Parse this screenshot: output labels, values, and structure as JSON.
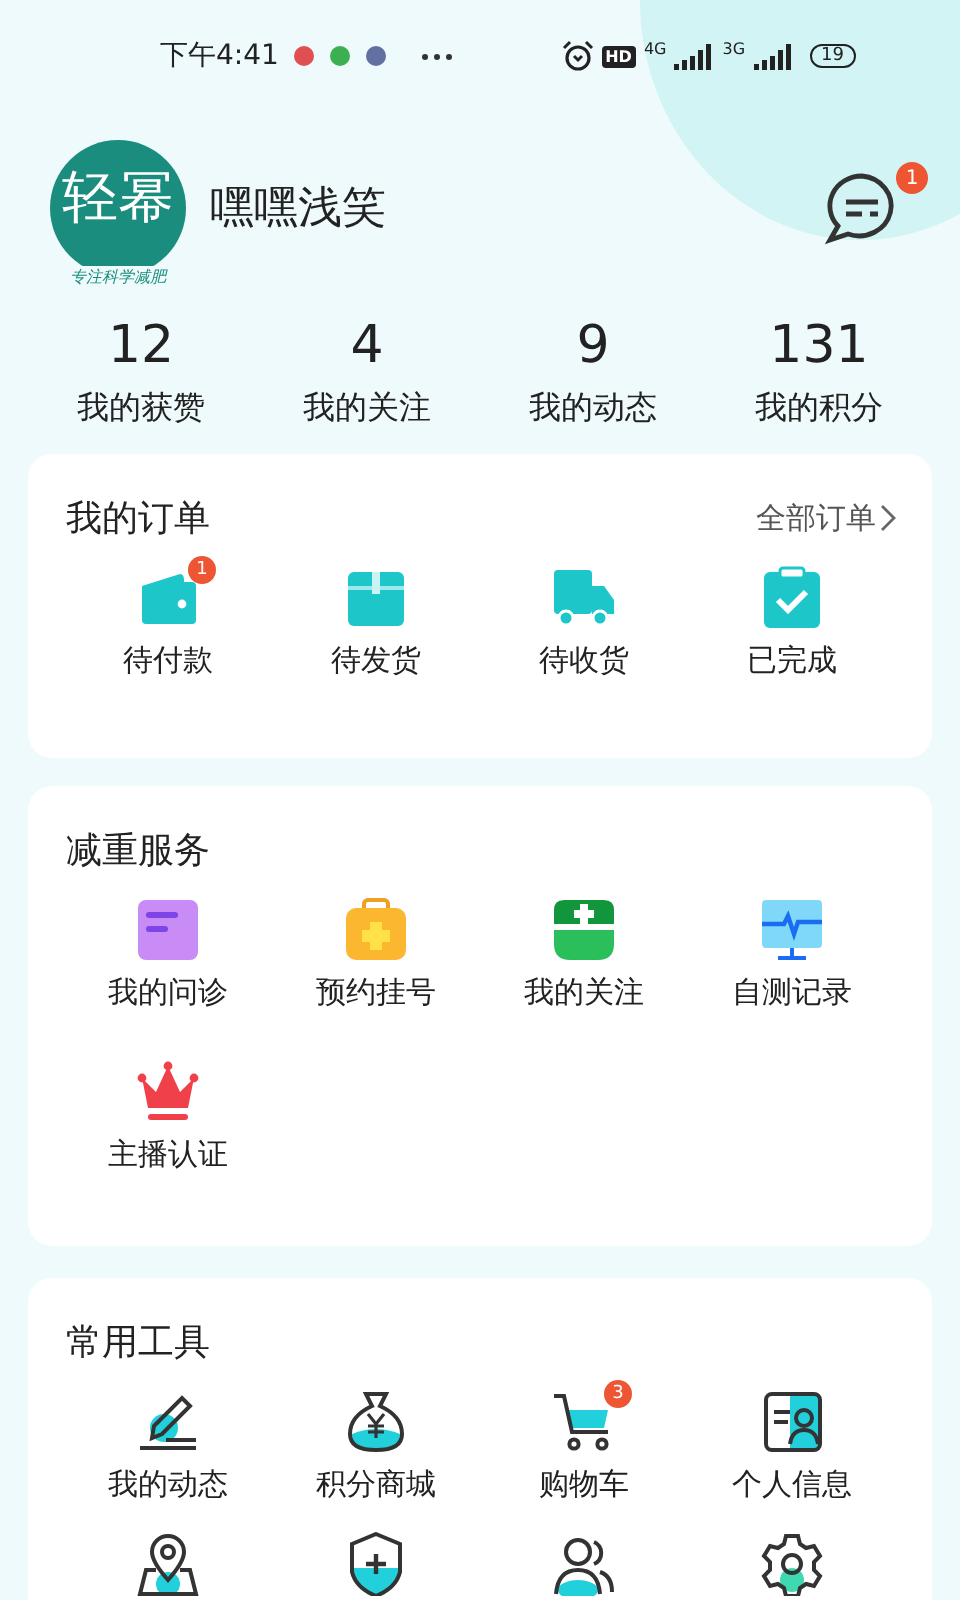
{
  "status_bar": {
    "time": "下午4:41",
    "network_1": "4G",
    "network_2": "3G",
    "hd": "HD",
    "battery": "19"
  },
  "profile": {
    "logo_text": "轻幂",
    "logo_slogan": "专注科学减肥",
    "username": "嘿嘿浅笑",
    "message_badge": "1"
  },
  "stats": [
    {
      "value": "12",
      "label": "我的获赞"
    },
    {
      "value": "4",
      "label": "我的关注"
    },
    {
      "value": "9",
      "label": "我的动态"
    },
    {
      "value": "131",
      "label": "我的积分"
    }
  ],
  "orders": {
    "title": "我的订单",
    "link": "全部订单",
    "items": [
      {
        "kind": "wallet",
        "label": "待付款",
        "badge": "1"
      },
      {
        "kind": "box",
        "label": "待发货"
      },
      {
        "kind": "truck",
        "label": "待收货"
      },
      {
        "kind": "clipboard",
        "label": "已完成"
      }
    ]
  },
  "services": {
    "title": "减重服务",
    "items": [
      {
        "kind": "note",
        "label": "我的问诊"
      },
      {
        "kind": "medkit",
        "label": "预约挂号"
      },
      {
        "kind": "cross",
        "label": "我的关注"
      },
      {
        "kind": "monitor",
        "label": "自测记录"
      },
      {
        "kind": "crown",
        "label": "主播认证"
      }
    ]
  },
  "tools": {
    "title": "常用工具",
    "items": [
      {
        "kind": "pen",
        "label": "我的动态"
      },
      {
        "kind": "moneybag",
        "label": "积分商城"
      },
      {
        "kind": "cart",
        "label": "购物车",
        "badge": "3"
      },
      {
        "kind": "idcard",
        "label": "个人信息"
      },
      {
        "kind": "pin"
      },
      {
        "kind": "shield"
      },
      {
        "kind": "people"
      },
      {
        "kind": "gear"
      }
    ]
  }
}
